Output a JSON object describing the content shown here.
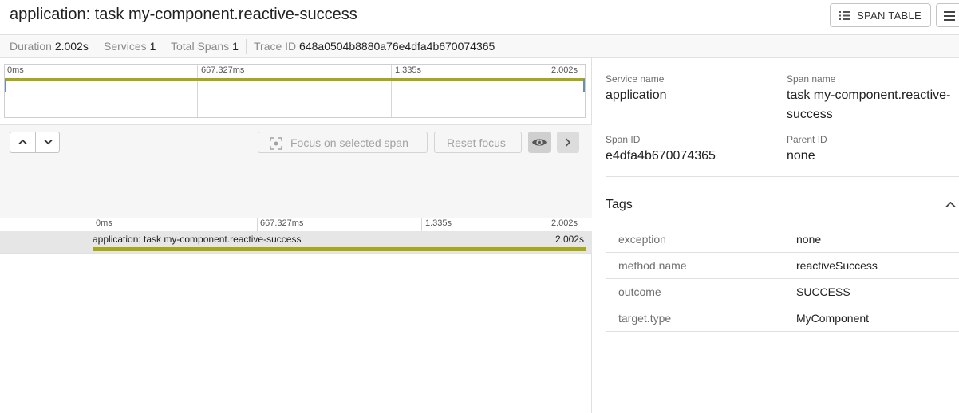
{
  "header": {
    "title": "application: task my-component.reactive-success",
    "span_table_label": "SPAN TABLE",
    "span_table_icon": "list-icon",
    "menu_icon": "hamburger-menu-icon"
  },
  "stats": {
    "duration_label": "Duration",
    "duration_value": "2.002s",
    "services_label": "Services",
    "services_value": "1",
    "spans_label": "Total Spans",
    "spans_value": "1",
    "trace_label": "Trace ID",
    "trace_value": "648a0504b8880a76e4dfa4b670074365"
  },
  "minimap": {
    "ticks": [
      "0ms",
      "667.327ms",
      "1.335s",
      "2.002s"
    ]
  },
  "toolbar": {
    "focus_label": "Focus on selected span",
    "reset_label": "Reset focus",
    "up_icon": "chevron-up-icon",
    "down_icon": "chevron-down-icon",
    "eye_icon": "eye-icon",
    "next_icon": "chevron-right-icon"
  },
  "timeline": {
    "ticks": [
      "0ms",
      "667.327ms",
      "1.335s",
      "2.002s"
    ]
  },
  "span": {
    "label": "application: task my-component.reactive-success",
    "duration": "2.002s",
    "bar_color": "#a6a81a",
    "start_fraction": 0,
    "end_fraction": 1
  },
  "details": {
    "service_name_label": "Service name",
    "service_name": "application",
    "span_name_label": "Span name",
    "span_name": "task my-component.reactive-success",
    "span_id_label": "Span ID",
    "span_id": "e4dfa4b670074365",
    "parent_id_label": "Parent ID",
    "parent_id": "none"
  },
  "tags": {
    "title": "Tags",
    "collapse_icon": "chevron-up-icon",
    "rows": [
      {
        "key": "exception",
        "value": "none"
      },
      {
        "key": "method.name",
        "value": "reactiveSuccess"
      },
      {
        "key": "outcome",
        "value": "SUCCESS"
      },
      {
        "key": "target.type",
        "value": "MyComponent"
      }
    ]
  }
}
